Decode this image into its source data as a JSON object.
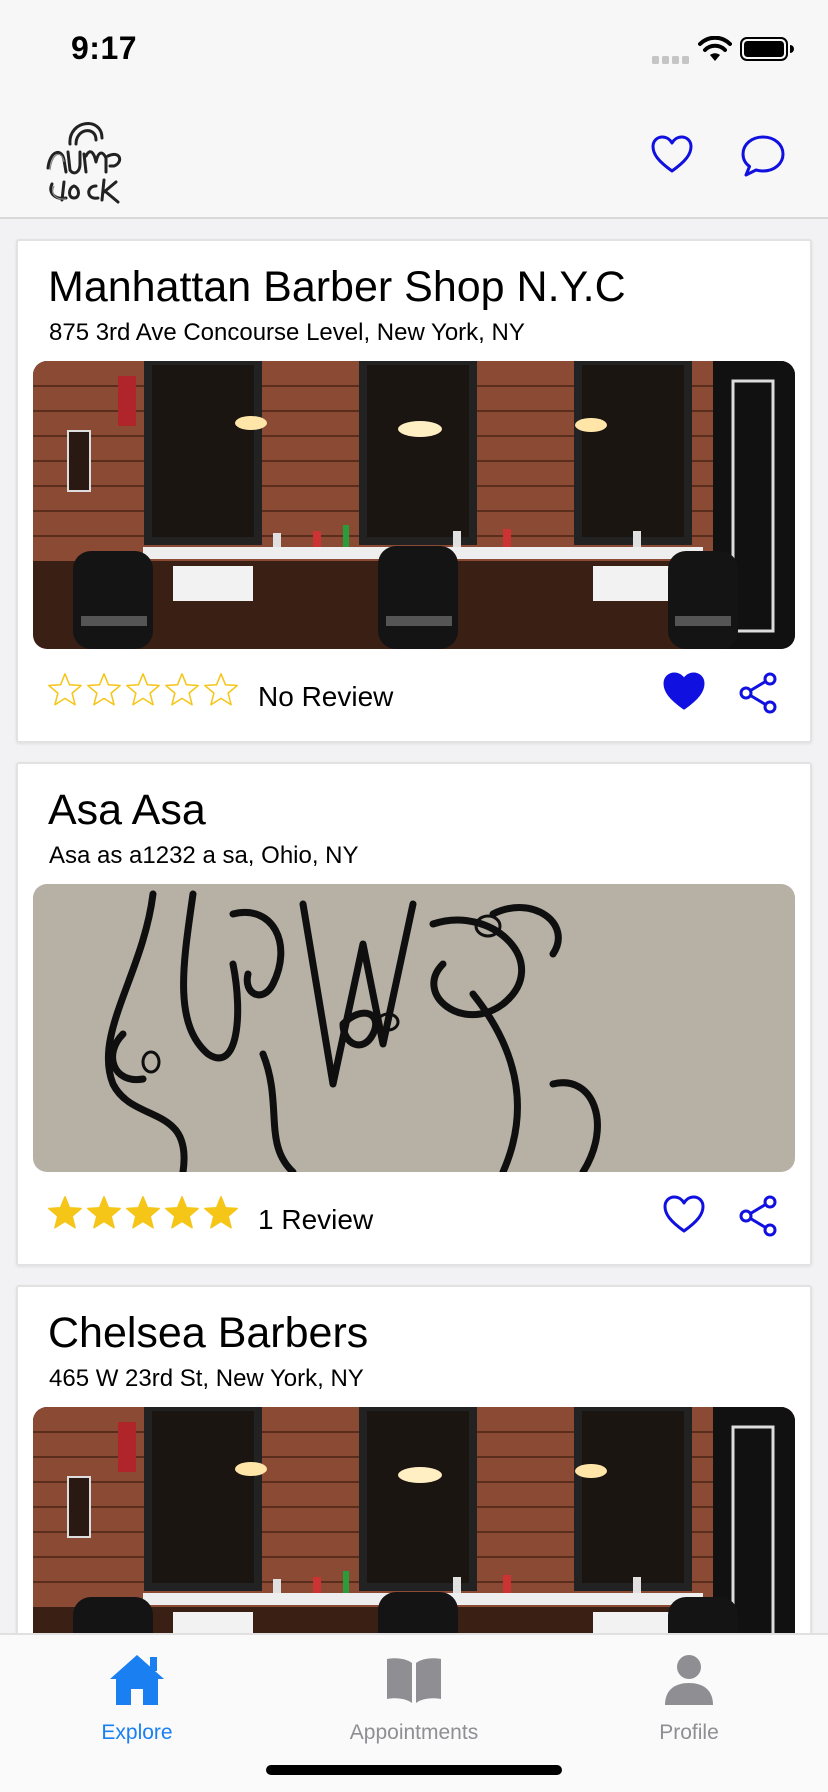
{
  "status_bar": {
    "time": "9:17"
  },
  "nav": {
    "logo_text": "Jump Lock"
  },
  "shops": [
    {
      "name": "Manhattan Barber Shop N.Y.C",
      "address": "875 3rd Ave Concourse Level, New York, NY",
      "rating": 0,
      "review_text": "No Review",
      "favorited": true,
      "photo": "barbershop-interior"
    },
    {
      "name": "Asa Asa",
      "address": "Asa as a1232 a sa, Ohio, NY",
      "rating": 5,
      "review_text": "1 Review",
      "favorited": false,
      "photo": "graffiti-wall"
    },
    {
      "name": "Chelsea Barbers",
      "address": "465 W 23rd St, New York, NY",
      "photo": "barbershop-interior"
    }
  ],
  "tabs": [
    {
      "label": "Explore",
      "icon": "home-icon",
      "active": true
    },
    {
      "label": "Appointments",
      "icon": "book-icon",
      "active": false
    },
    {
      "label": "Profile",
      "icon": "person-icon",
      "active": false
    }
  ],
  "colors": {
    "accent": "#1010e0",
    "tab_active": "#1a7ff0",
    "tab_inactive": "#8e8e93",
    "star": "#f5c518"
  }
}
